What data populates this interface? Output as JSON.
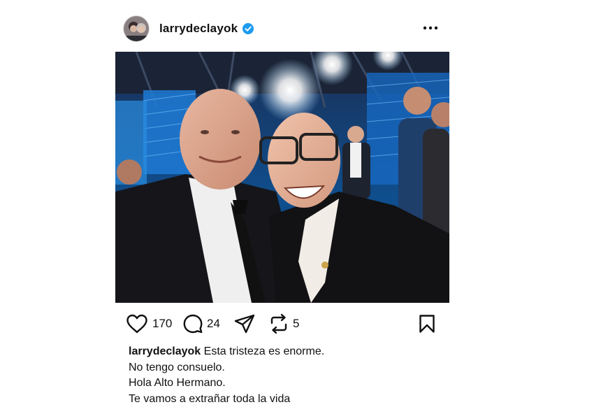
{
  "post": {
    "username": "larrydeclayok",
    "verified_icon": "verified-badge-icon",
    "more_icon": "more-options-icon",
    "image_alt": "Selfie of two men in suits smiling on a television studio set"
  },
  "actions": {
    "likes": "170",
    "comments": "24",
    "reposts": "5",
    "icons": [
      "heart-icon",
      "comment-icon",
      "share-icon",
      "repost-icon",
      "bookmark-icon"
    ]
  },
  "caption": {
    "username": "larrydeclayok",
    "first_line": "Esta tristeza es enorme.",
    "lines": [
      "No tengo consuelo.",
      "Hola Alto Hermano.",
      "Te vamos a extrañar toda la vida"
    ]
  },
  "colors": {
    "verified": "#1d9bf0",
    "text": "#111111"
  }
}
